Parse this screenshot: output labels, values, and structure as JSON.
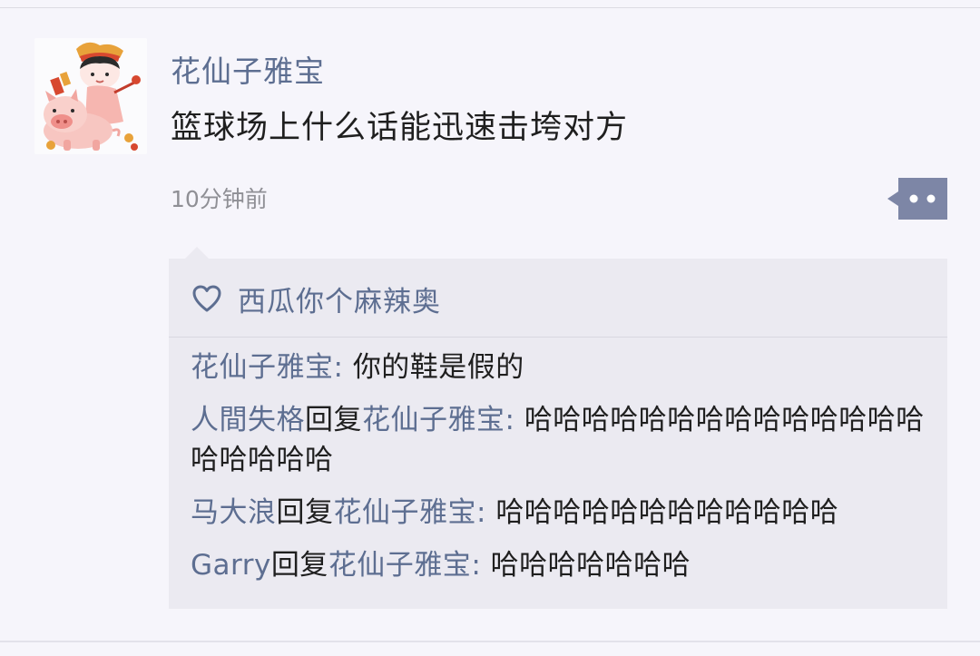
{
  "post": {
    "author": "花仙子雅宝",
    "text": "篮球场上什么话能迅速击垮对方",
    "timestamp": "10分钟前"
  },
  "icons": {
    "avatar": "pig-cartoon-avatar",
    "more": "more-dots-icon",
    "like": "heart-outline-icon"
  },
  "colors": {
    "name": "#5d6e91",
    "text": "#1f1f1f",
    "muted": "#8f8f95",
    "panel": "#ebeaf1",
    "button": "#7d86a6"
  },
  "likes": {
    "names": "西瓜你个麻辣奥"
  },
  "comments": [
    {
      "author": "花仙子雅宝",
      "reply_word": "",
      "reply_to": "",
      "separator": ": ",
      "text": "你的鞋是假的"
    },
    {
      "author": "人間失格",
      "reply_word": "回复",
      "reply_to": "花仙子雅宝",
      "separator": ": ",
      "text": "哈哈哈哈哈哈哈哈哈哈哈哈哈哈哈哈哈哈哈"
    },
    {
      "author": "马大浪",
      "reply_word": "回复",
      "reply_to": "花仙子雅宝",
      "separator": ": ",
      "text": "哈哈哈哈哈哈哈哈哈哈哈哈"
    },
    {
      "author": "Garry",
      "reply_word": "回复",
      "reply_to": "花仙子雅宝",
      "separator": ": ",
      "text": "哈哈哈哈哈哈哈"
    }
  ]
}
